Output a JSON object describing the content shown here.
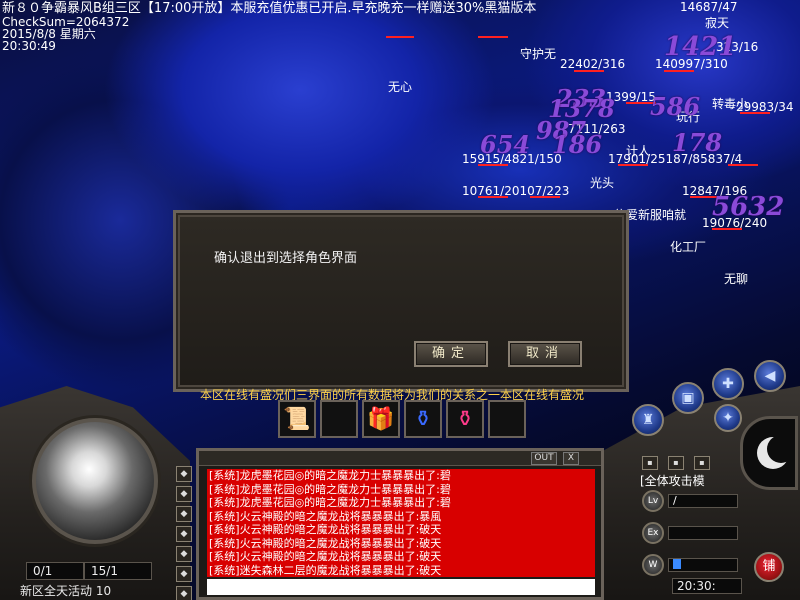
{
  "hud": {
    "title_line": "新８０争霸暴风B组三区【17:00开放】本服充值优惠已开启.早充晚充一样赠送30%黑猫版本",
    "checksum": "CheckSum=2064372",
    "date": "2015/8/8 星期六",
    "time": "20:30:49"
  },
  "world_labels": {
    "guard": "守护无",
    "none": "无心",
    "top_name": "寂天",
    "turtle": "转毒小",
    "light": "光头",
    "player_pk": "计人",
    "player_xin": "信爱新服咱就",
    "chem_factory": "化工厂",
    "none_right": "无聊",
    "finish": "玩行"
  },
  "hp_labels": [
    "22402/316",
    "140997/310",
    "323/16",
    "1399/15",
    "7111/263",
    "29983/34",
    "15915/4821/150",
    "17901/25187/85837/4",
    "10761/20107/223",
    "12847/196",
    "19076/240",
    "14687/47"
  ],
  "damage_numbers": [
    "1421",
    "233",
    "1378",
    "987",
    "186",
    "654",
    "586",
    "178",
    "5632"
  ],
  "dialog": {
    "message": "确认退出到选择角色界面",
    "confirm": "确定",
    "cancel": "取消"
  },
  "scroll_text": "本区在线有盛况们三界面的所有数据将为我们的关系之一本区在线有盛况",
  "chat": {
    "out_label": "OUT",
    "close_label": "X",
    "lines": [
      "[系统]龙虎墨花园◎的暗之魔龙力士暴暴暴出了:碧",
      "[系统]龙虎墨花园◎的暗之魔龙力士暴暴暴出了:碧",
      "[系统]龙虎墨花园◎的暗之魔龙力士暴暴暴出了:碧",
      "[系统]火云神殿的暗之魔龙战将暴暴暴出了:暴風",
      "[系统]火云神殿的暗之魔龙战将暴暴暴出了:破天",
      "[系统]火云神殿的暗之魔龙战将暴暴暴出了:破天",
      "[系统]火云神殿的暗之魔龙战将暴暴暴出了:破天",
      "[系统]迷失森林二层的魔龙战将暴暴暴出了:破天"
    ]
  },
  "left_panel": {
    "hp_box": "0/1",
    "mp_box": "15/1",
    "area_name": "新区全天活动 10"
  },
  "right_panel": {
    "attack_mode": "[全体攻击模",
    "clock": "20:30:",
    "shop": "铺",
    "sub_bar_1": "/",
    "sub_bar_2": ""
  },
  "colors": {
    "health_bar": "#ff2020",
    "damage_text": "#8a4ad8",
    "chat_bg": "#d80000",
    "scroll_text": "#ffd24a"
  },
  "icons": {
    "belt": [
      "scroll-icon",
      "empty-slot",
      "gift-box-icon",
      "blue-potion-icon",
      "red-potion-icon",
      "empty-slot"
    ],
    "round_buttons": [
      "character-icon",
      "bag-icon",
      "skill-icon",
      "map-icon",
      "sound-icon",
      "guild-icon"
    ]
  }
}
